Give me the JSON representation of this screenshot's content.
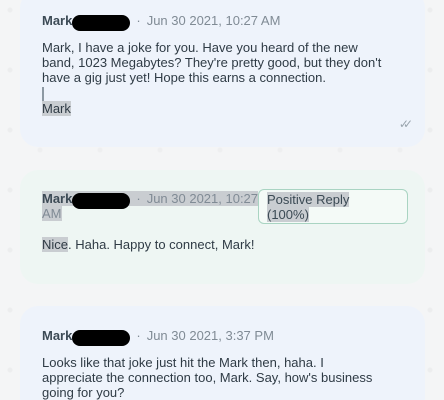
{
  "messages": [
    {
      "sender": "Mark",
      "timestamp": "Jun 30 2021, 10:27 AM",
      "body_lines": [
        "Mark, I have a joke for you. Have you heard of the new",
        "band, 1023 Megabytes? They're pretty good, but they don't",
        "have a gig just yet! Hope this earns a connection."
      ],
      "signature": "Mark",
      "status_icon": "double-check-icon"
    },
    {
      "sender": "Mark",
      "timestamp_line1": "Jun 30 2021, 10:27",
      "timestamp_line2": "AM",
      "badge_line1": "Positive Reply",
      "badge_line2": "(100%)",
      "body_highlight": "Nice",
      "body_rest": ". Haha. Happy to connect, Mark!"
    },
    {
      "sender": "Mark",
      "timestamp": "Jun 30 2021, 3:37 PM",
      "body_lines": [
        "Looks like that joke just hit the Mark then, haha. I",
        "appreciate the connection too, Mark. Say, how's business",
        "going for you?"
      ]
    }
  ]
}
